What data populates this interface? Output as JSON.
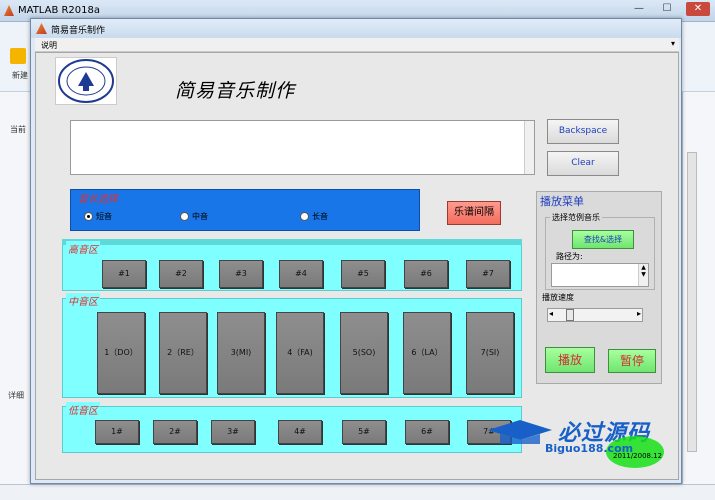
{
  "matlab": {
    "title": "MATLAB R2018a",
    "new_label": "新建",
    "current_folder_label": "当前",
    "details_label": "详细"
  },
  "figure": {
    "title": "简易音乐制作",
    "menu_help": "说明",
    "app_title": "简易音乐制作",
    "buttons": {
      "backspace": "Backspace",
      "clear": "Clear",
      "interval": "乐谱间隔"
    },
    "tone": {
      "title": "音长选择",
      "options": [
        {
          "label": "短音",
          "selected": true
        },
        {
          "label": "中音",
          "selected": false
        },
        {
          "label": "长音",
          "selected": false
        }
      ]
    },
    "zones": {
      "high": {
        "label": "高音区",
        "keys": [
          "#1",
          "#2",
          "#3",
          "#4",
          "#5",
          "#6",
          "#7"
        ]
      },
      "mid": {
        "label": "中音区",
        "keys": [
          "1（DO）",
          "2（RE）",
          "3(MI)",
          "4（FA)",
          "5(SO)",
          "6（LA）",
          "7(SI)"
        ]
      },
      "low": {
        "label": "低音区",
        "keys": [
          "1#",
          "2#",
          "3#",
          "4#",
          "5#",
          "6#",
          "7#"
        ]
      }
    },
    "play": {
      "title": "播放菜单",
      "sample_title": "选择范例音乐",
      "find_button": "查找&选择",
      "path_label": "路径为:",
      "speed_title": "播放速度",
      "speed_fraction": 0.12,
      "play_button": "播放",
      "pause_button": "暂停"
    }
  },
  "watermark": {
    "text": "必过源码",
    "url": "Biguo188.com",
    "date": "2011/2008.12"
  }
}
